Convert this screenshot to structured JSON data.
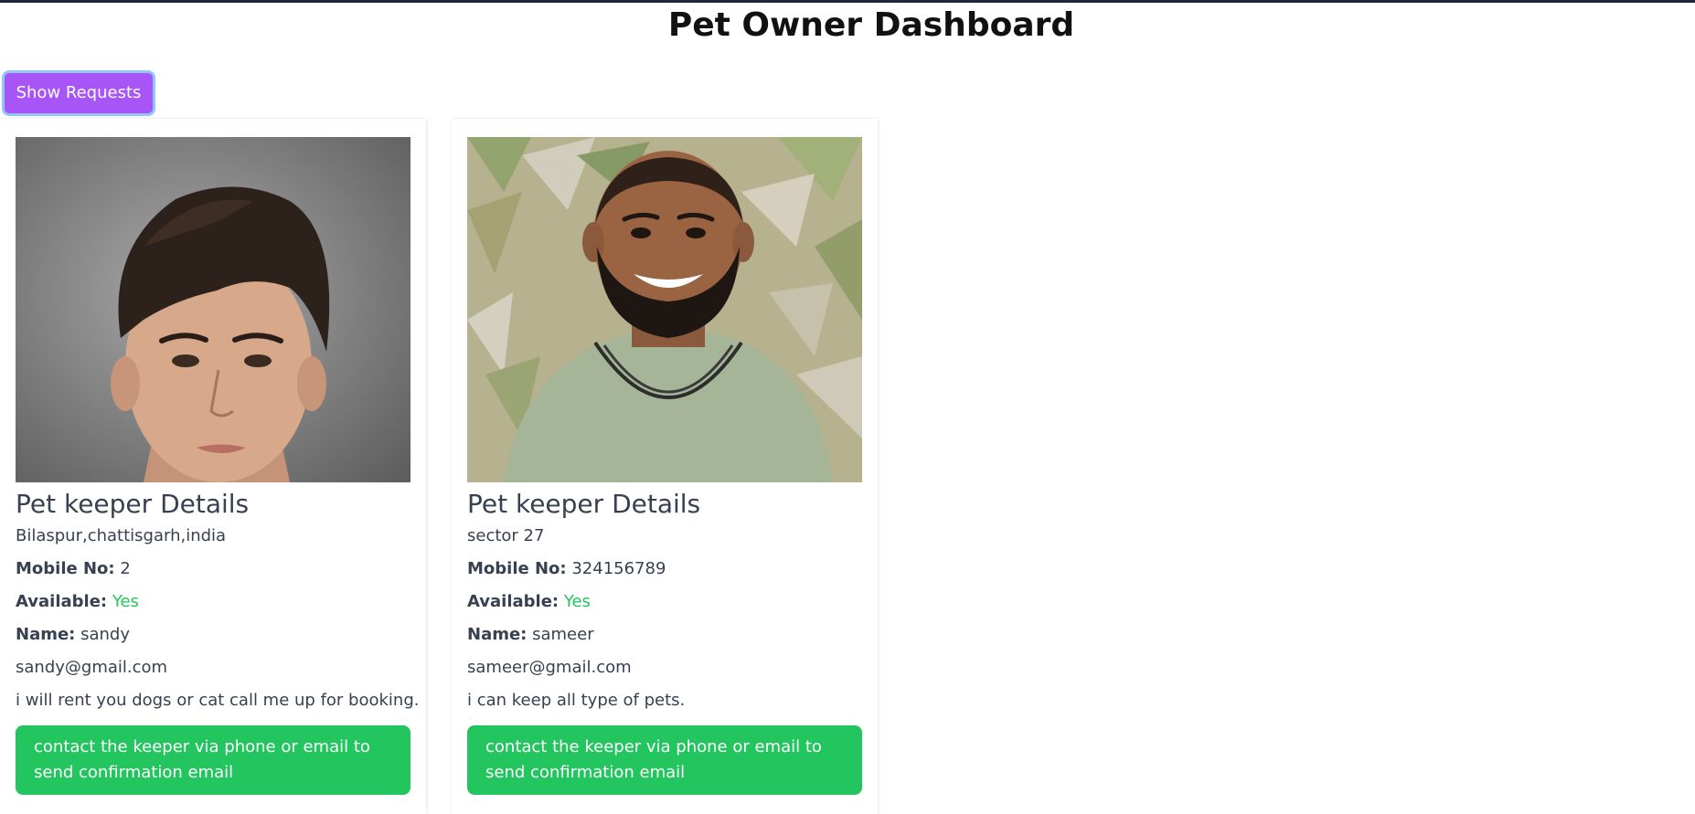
{
  "header": {
    "title": "Pet Owner Dashboard"
  },
  "toolbar": {
    "show_requests_label": "Show Requests"
  },
  "keepers": [
    {
      "details_title": "Pet keeper Details",
      "location": "Bilaspur,chattisgarh,india",
      "mobile_label": "Mobile No:",
      "mobile": "2",
      "available_label": "Available:",
      "available": "Yes",
      "name_label": "Name:",
      "name": "sandy",
      "email": "sandy@gmail.com",
      "description": "i will rent you dogs or cat call me up for booking.",
      "contact_label": "contact the keeper via phone or email to send confirmation email"
    },
    {
      "details_title": "Pet keeper Details",
      "location": "sector 27",
      "mobile_label": "Mobile No:",
      "mobile": "324156789",
      "available_label": "Available:",
      "available": "Yes",
      "name_label": "Name:",
      "name": "sameer",
      "email": "sameer@gmail.com",
      "description": "i can keep all type of pets.",
      "contact_label": "contact the keeper via phone or email to send confirmation email"
    }
  ],
  "colors": {
    "primary_purple": "#a855f7",
    "success_green": "#22c55e",
    "text_gray": "#374151"
  }
}
